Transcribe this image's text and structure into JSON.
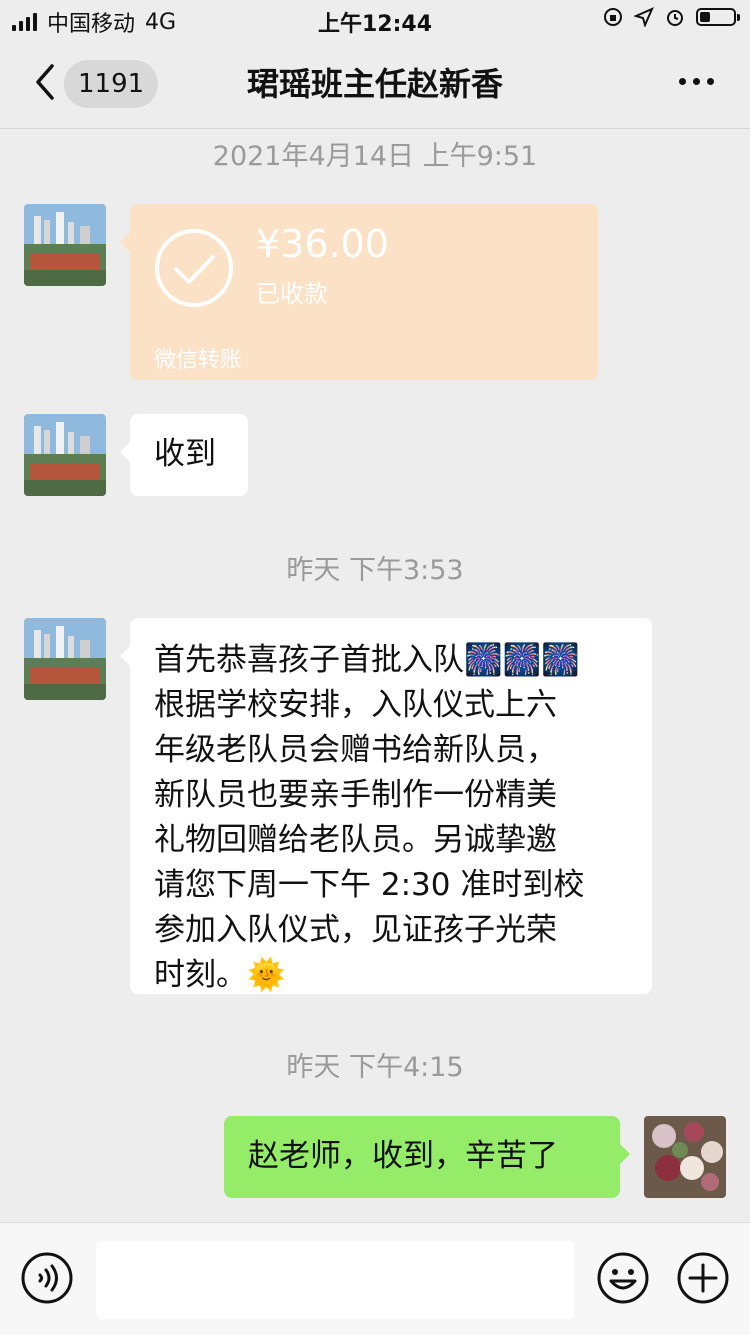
{
  "status_bar": {
    "carrier": "中国移动",
    "network": "4G",
    "time": "上午12:44",
    "battery_level": 0.3
  },
  "nav": {
    "back_icon": "chevron-left-icon",
    "unread_count": "1191",
    "title": "珺瑶班主任赵新香",
    "more_icon": "more-dots-icon"
  },
  "chat": {
    "timestamps": [
      "2021年4月14日 上午9:51",
      "昨天 下午3:53",
      "昨天 下午4:15"
    ],
    "transfer": {
      "amount": "¥36.00",
      "status": "已收款",
      "brand": "微信转账"
    },
    "messages": [
      {
        "from": "other",
        "text": "收到"
      },
      {
        "from": "other",
        "lines": [
          "首先恭喜孩子首批入队🎆🎆🎆",
          "根据学校安排，入队仪式上六",
          "年级老队员会赠书给新队员，",
          "新队员也要亲手制作一份精美",
          "礼物回赠给老队员。另诚挚邀",
          "请您下周一下午 2:30 准时到校",
          "参加入队仪式，见证孩子光荣",
          "时刻。🌞"
        ]
      },
      {
        "from": "me",
        "text": "赵老师，收到，辛苦了"
      }
    ]
  },
  "input_bar": {
    "voice_icon": "voice-icon",
    "emoji_icon": "emoji-icon",
    "plus_icon": "plus-icon"
  },
  "colors": {
    "background": "#ededed",
    "my_bubble": "#95ec69",
    "transfer_bg": "#fbe1c5"
  }
}
